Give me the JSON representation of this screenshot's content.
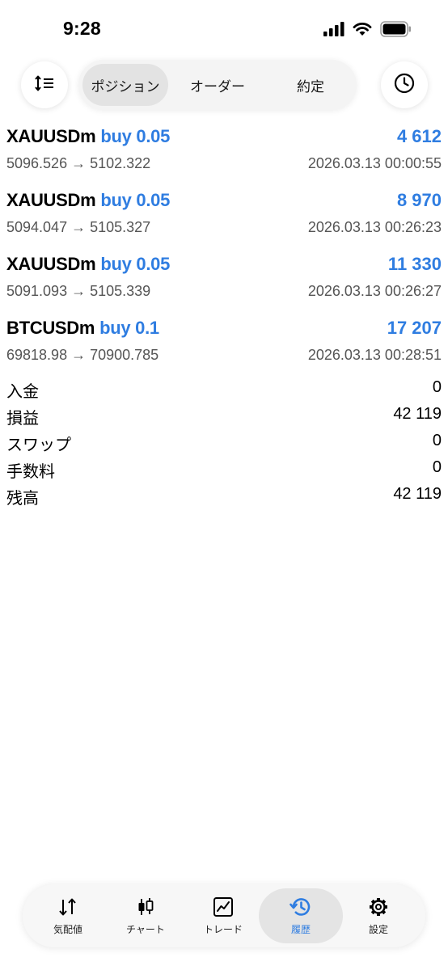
{
  "status_bar": {
    "time": "9:28",
    "icons": [
      "signal-icon",
      "wifi-icon",
      "battery-icon"
    ]
  },
  "top_bar": {
    "sort_icon": "sort-icon",
    "history_icon": "clock-icon",
    "tabs": [
      {
        "label": "ポジション",
        "active": true
      },
      {
        "label": "オーダー",
        "active": false
      },
      {
        "label": "約定",
        "active": false
      }
    ]
  },
  "deals": [
    {
      "symbol": "XAUUSDm",
      "side": "buy 0.05",
      "profit": "4 612",
      "prices": "5096.526 → 5102.322",
      "time": "2026.03.13 00:00:55"
    },
    {
      "symbol": "XAUUSDm",
      "side": "buy 0.05",
      "profit": "8 970",
      "prices": "5094.047 → 5105.327",
      "time": "2026.03.13 00:26:23"
    },
    {
      "symbol": "XAUUSDm",
      "side": "buy 0.05",
      "profit": "11 330",
      "prices": "5091.093 → 5105.339",
      "time": "2026.03.13 00:26:27"
    },
    {
      "symbol": "BTCUSDm",
      "side": "buy 0.1",
      "profit": "17 207",
      "prices": "69818.98 → 70900.785",
      "time": "2026.03.13 00:28:51"
    }
  ],
  "summary": [
    {
      "label": "入金",
      "value": "0"
    },
    {
      "label": "損益",
      "value": "42 119"
    },
    {
      "label": "スワップ",
      "value": "0"
    },
    {
      "label": "手数料",
      "value": "0"
    },
    {
      "label": "残高",
      "value": "42 119"
    }
  ],
  "tab_bar": {
    "items": [
      {
        "label": "気配値",
        "icon": "arrows-updown-icon",
        "active": false
      },
      {
        "label": "チャート",
        "icon": "candlestick-icon",
        "active": false
      },
      {
        "label": "トレード",
        "icon": "trade-chart-icon",
        "active": false
      },
      {
        "label": "履歴",
        "icon": "history-icon",
        "active": true
      },
      {
        "label": "設定",
        "icon": "gear-icon",
        "active": false
      }
    ]
  },
  "colors": {
    "accent": "#2f7de1",
    "text": "#000000",
    "secondary_text": "#555555"
  }
}
